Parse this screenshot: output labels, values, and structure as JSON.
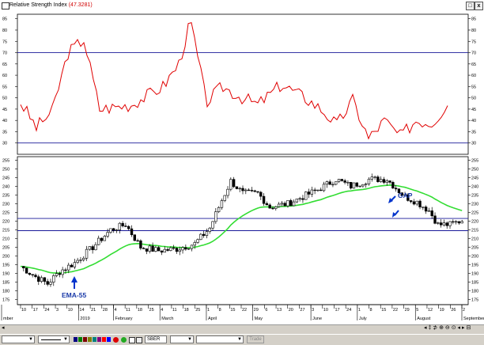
{
  "window": {
    "title": "Relative Strength Index",
    "title_value": "(47.3281)",
    "btn_restore": "□",
    "btn_close": "x"
  },
  "rsi_panel": {
    "y_ticks": [
      "85",
      "80",
      "75",
      "70",
      "65",
      "60",
      "55",
      "50",
      "45",
      "40",
      "35",
      "30"
    ],
    "y_range": [
      25,
      87
    ],
    "levels": [
      70,
      30
    ],
    "line_color": "#e00000"
  },
  "price_panel": {
    "y_ticks": [
      "255",
      "250",
      "245",
      "240",
      "235",
      "230",
      "225",
      "220",
      "215",
      "210",
      "205",
      "200",
      "195",
      "190",
      "185",
      "180",
      "175"
    ],
    "y_range": [
      172,
      257
    ],
    "levels": [
      221.5,
      214.5
    ],
    "ema_color": "#33dd33",
    "annotations": {
      "ema_label": "EMA-55",
      "gap_label": "GAP"
    }
  },
  "x_axis": {
    "ticks": [
      "10",
      "17",
      "24",
      "3",
      "10",
      "14",
      "21",
      "28",
      "4",
      "11",
      "18",
      "25",
      "4",
      "11",
      "18",
      "25",
      "1",
      "8",
      "15",
      "22",
      "29",
      "6",
      "13",
      "20",
      "27",
      "3",
      "10",
      "17",
      "24",
      "1",
      "8",
      "15",
      "22",
      "29",
      "5",
      "12",
      "19",
      "26",
      "2"
    ],
    "months": [
      "mber",
      "2019",
      "February",
      "March",
      "April",
      "May",
      "June",
      "July",
      "August",
      "September"
    ]
  },
  "toolbar": {
    "ticker": "SBER",
    "trade_label": "Trade",
    "swatches": [
      "#000080",
      "#008000",
      "#800000",
      "#808000",
      "#008080",
      "#800080",
      "#ff0000",
      "#0000ff"
    ]
  },
  "statusbar": {
    "nav_glyphs": "◂ ‡ ⊅ ⊕ ⊖ ⊙ ◂ ▸ ⊟"
  }
}
